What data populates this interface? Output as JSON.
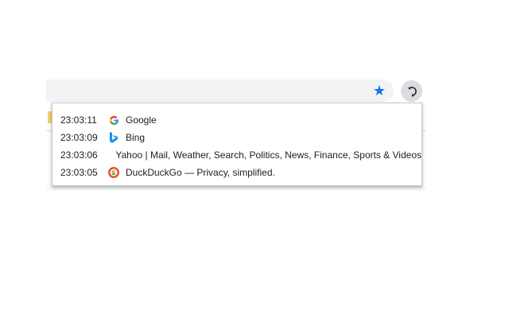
{
  "history": [
    {
      "time": "23:03:11",
      "title": "Google",
      "icon": "google-icon"
    },
    {
      "time": "23:03:09",
      "title": "Bing",
      "icon": "bing-icon"
    },
    {
      "time": "23:03:06",
      "title": "Yahoo | Mail, Weather, Search, Politics, News, Finance, Sports & Videos",
      "icon": "none"
    },
    {
      "time": "23:03:05",
      "title": "DuckDuckGo — Privacy, simplified.",
      "icon": "duckduckgo-icon"
    }
  ],
  "colors": {
    "accent": "#1a73e8",
    "omnibox": "#f1f3f4"
  }
}
